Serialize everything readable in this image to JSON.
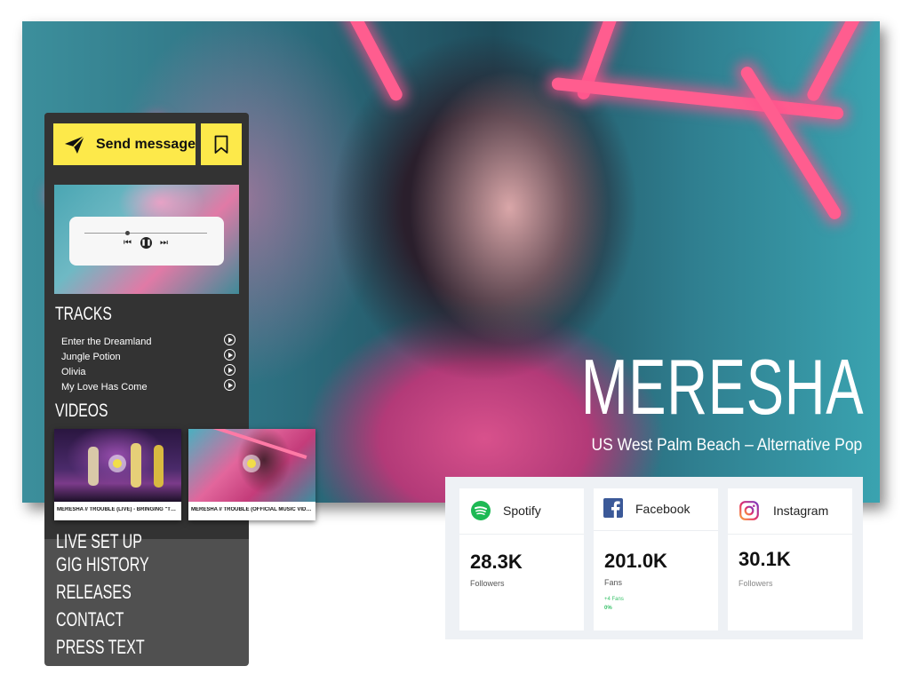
{
  "hero": {
    "artist_name": "MERESHA",
    "artist_subtitle": "US West Palm Beach – Alternative Pop"
  },
  "actions": {
    "send_message_label": "Send message",
    "bookmark_icon": "bookmark-icon",
    "send_icon": "paper-plane-icon"
  },
  "player": {
    "progress": 0.35,
    "controls": [
      "previous-icon",
      "pause-icon",
      "next-icon"
    ]
  },
  "tracks": {
    "heading": "TRACKS",
    "items": [
      {
        "title": "Enter the Dreamland"
      },
      {
        "title": "Jungle Potion"
      },
      {
        "title": "Olivia"
      },
      {
        "title": "My Love Has Come"
      }
    ]
  },
  "videos": {
    "heading": "VIDEOS",
    "items": [
      {
        "caption": "MERESHA // TROUBLE (LIVE) - BRINGING \"TR..."
      },
      {
        "caption": "MERESHA // TROUBLE (OFFICIAL MUSIC VIDE..."
      }
    ]
  },
  "nav": {
    "items": [
      "LIVE SET UP",
      "GIG HISTORY",
      "RELEASES",
      "CONTACT",
      "PRESS TEXT"
    ]
  },
  "stats": {
    "spotify": {
      "label": "Spotify",
      "value": "28.3K",
      "unit": "Followers",
      "icon": "spotify-icon",
      "color": "#1db954"
    },
    "facebook": {
      "label": "Facebook",
      "value": "201.0K",
      "unit": "Fans",
      "delta": "+4 Fans",
      "delta_pct": "0%",
      "icon": "facebook-icon",
      "color": "#3b5998"
    },
    "instagram": {
      "label": "Instagram",
      "value": "30.1K",
      "unit": "Followers",
      "icon": "instagram-icon"
    }
  },
  "colors": {
    "accent_yellow": "#fde94a",
    "sidebar_dark": "#333333",
    "sidebar_mid": "#505050",
    "neon_pink": "#ff5d8f"
  }
}
